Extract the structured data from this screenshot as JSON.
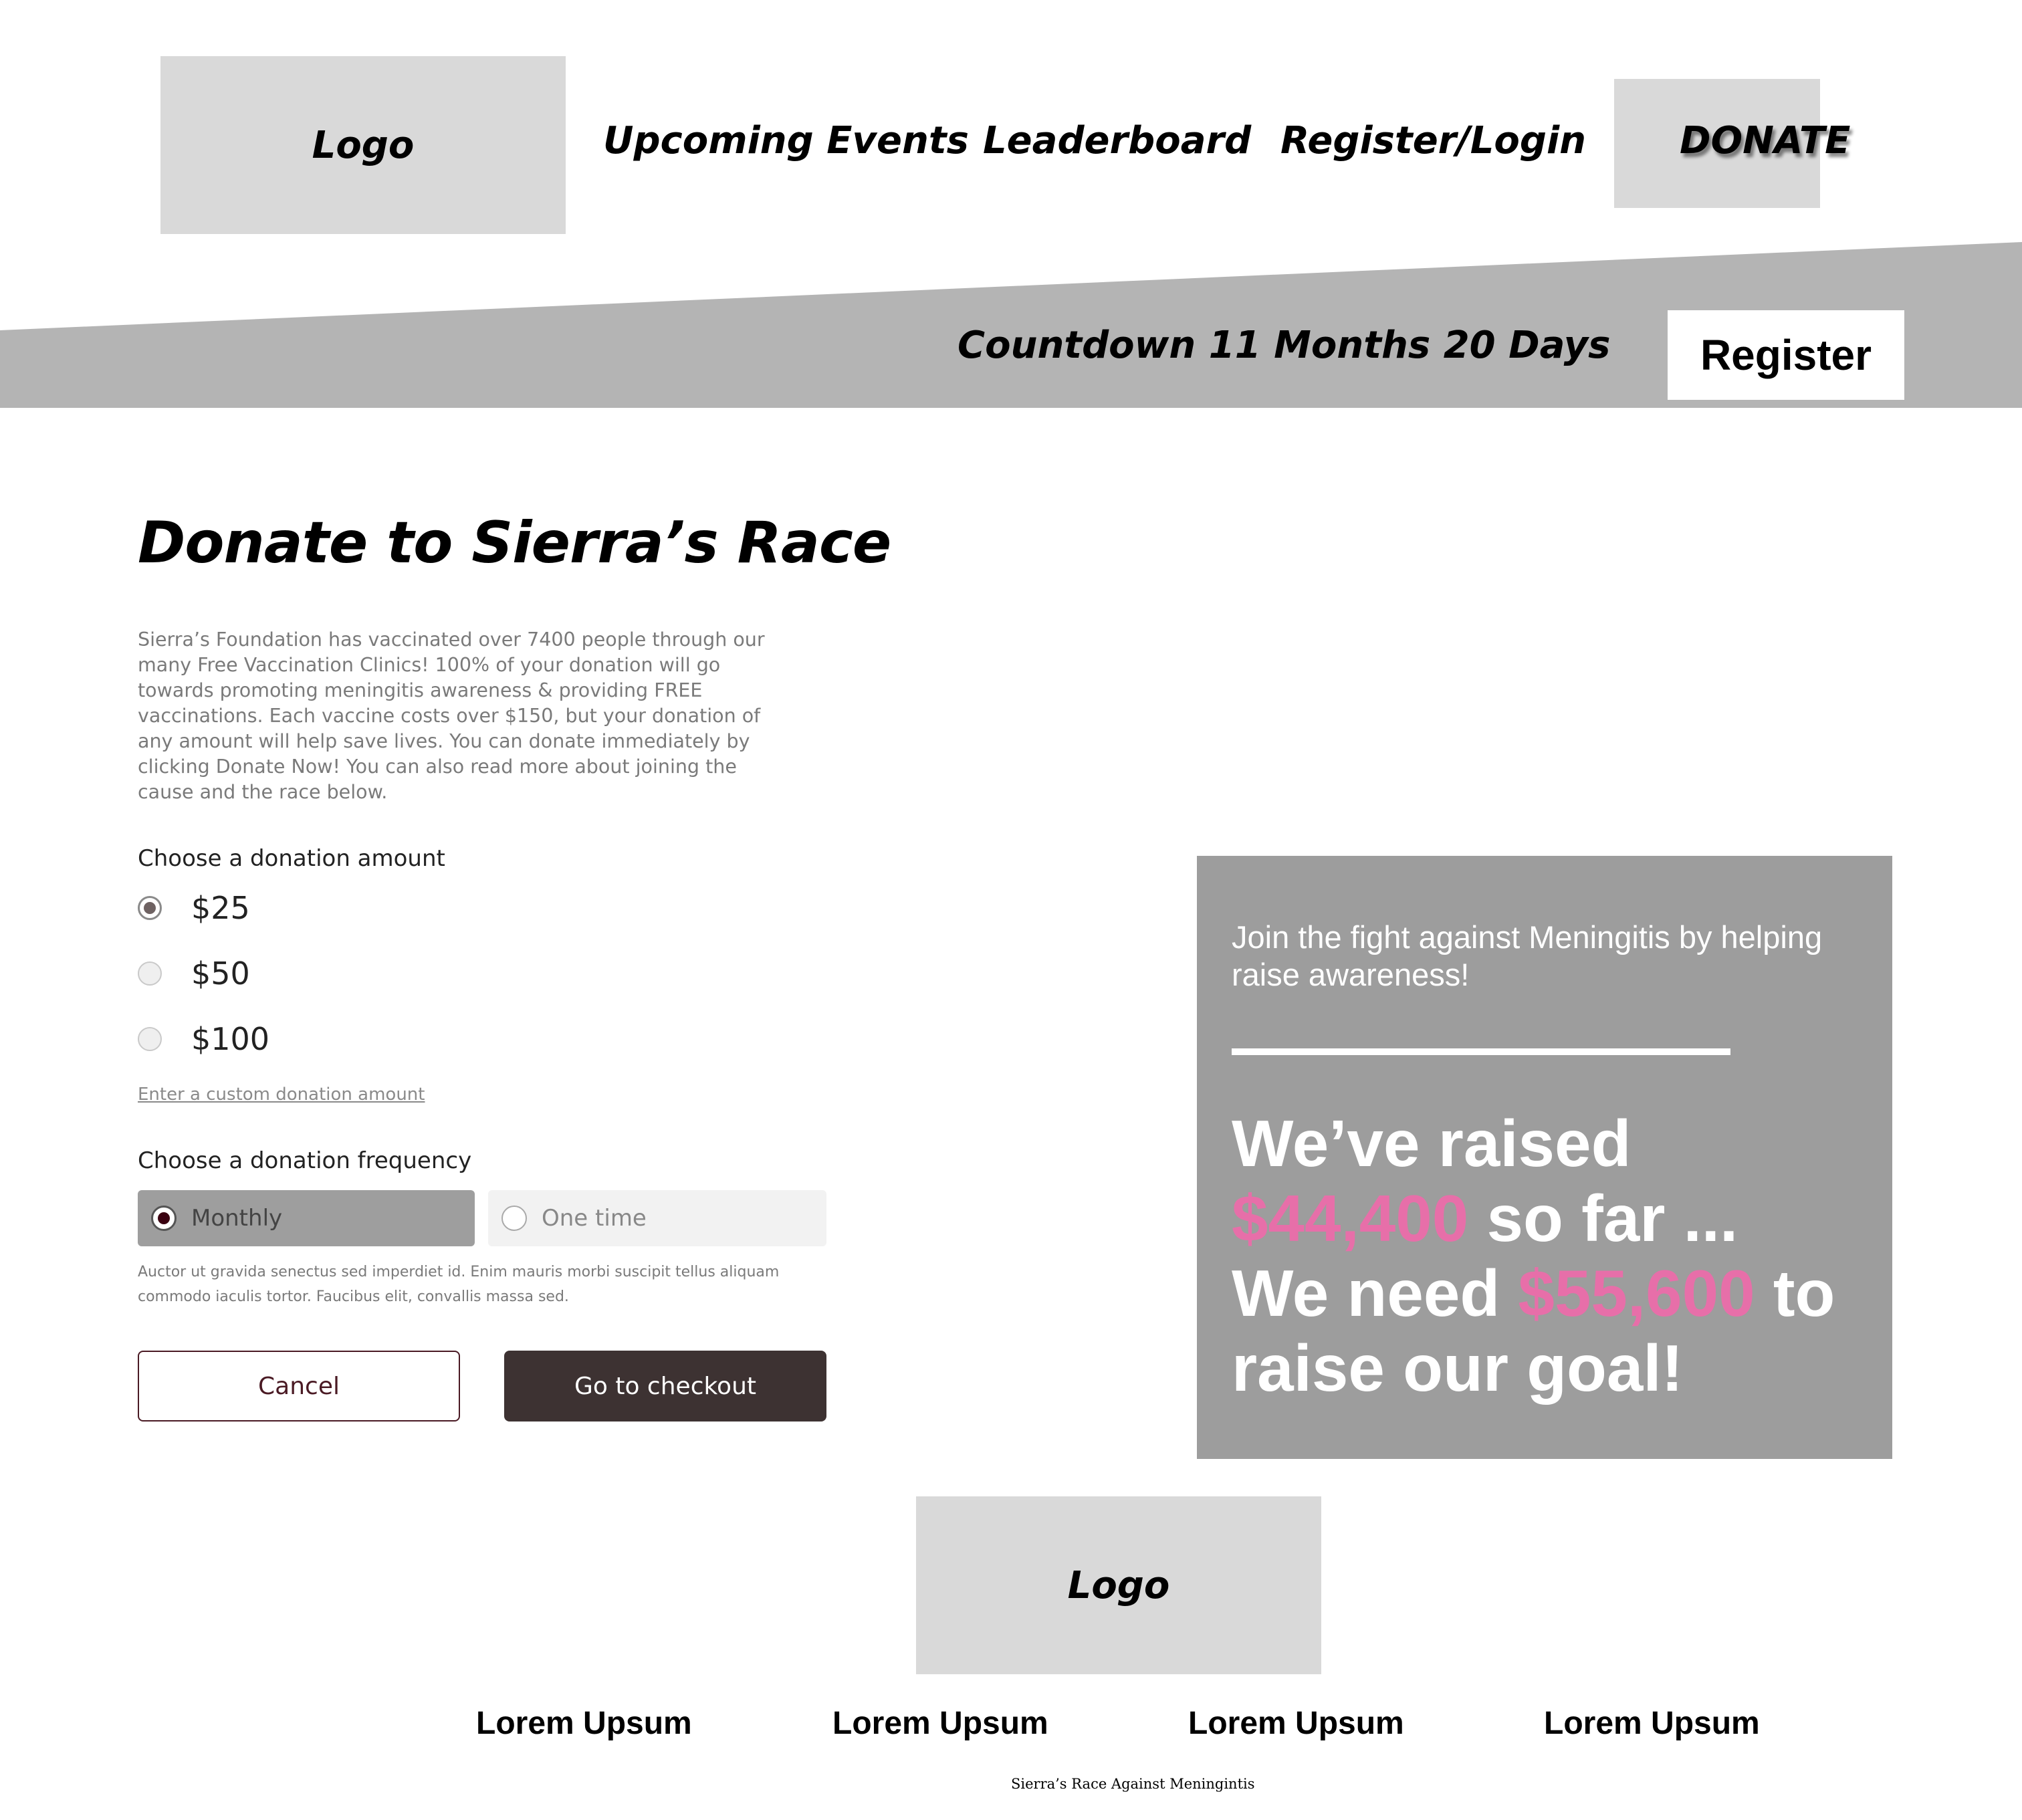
{
  "header": {
    "logo": "Logo",
    "nav": [
      "Upcoming Events",
      "Leaderboard",
      "Register/Login"
    ],
    "donate": "DONATE"
  },
  "banner": {
    "countdown": "Countdown 11 Months 20 Days",
    "register": "Register"
  },
  "main": {
    "title": "Donate to Sierra’s Race",
    "intro": "Sierra’s Foundation has vaccinated over 7400 people through our many Free Vaccination Clinics! 100% of your donation will go towards promoting meningitis awareness & providing FREE vaccinations. Each vaccine costs over $150, but your donation of any amount will help save lives. You can donate immediately by clicking Donate Now! You can also read more about joining the cause and the race below.",
    "amount_label": "Choose a donation amount",
    "amounts": [
      {
        "label": "$25",
        "selected": true
      },
      {
        "label": "$50",
        "selected": false
      },
      {
        "label": "$100",
        "selected": false
      }
    ],
    "custom_amount": "Enter a custom donation amount",
    "frequency_label": "Choose a donation frequency",
    "frequencies": [
      {
        "label": "Monthly",
        "selected": true
      },
      {
        "label": "One time",
        "selected": false
      }
    ],
    "fine_print": "Auctor ut gravida senectus sed imperdiet id. Enim mauris morbi suscipit tellus aliquam commodo iaculis tortor. Faucibus elit, convallis massa sed.",
    "cancel": "Cancel",
    "checkout": "Go to checkout"
  },
  "panel": {
    "subtitle": "Join the fight against Meningitis by helping raise awareness!",
    "raised_prefix": "We’ve raised",
    "raised_amount": "$44,400",
    "raised_suffix": "so far ...",
    "need_prefix": "We need",
    "need_amount": "$55,600",
    "need_suffix": "to raise our goal!",
    "highlight_color": "#e76fa9"
  },
  "footer": {
    "logo": "Logo",
    "links": [
      "Lorem Upsum",
      "Lorem Upsum",
      "Lorem Upsum",
      "Lorem Upsum"
    ],
    "copyright": "Sierra’s Race Against Meningintis"
  },
  "colors": {
    "band": "#b4b4b4",
    "placeholder": "#d9d9d9",
    "panel": "#9d9d9d",
    "checkout": "#3d3232"
  }
}
